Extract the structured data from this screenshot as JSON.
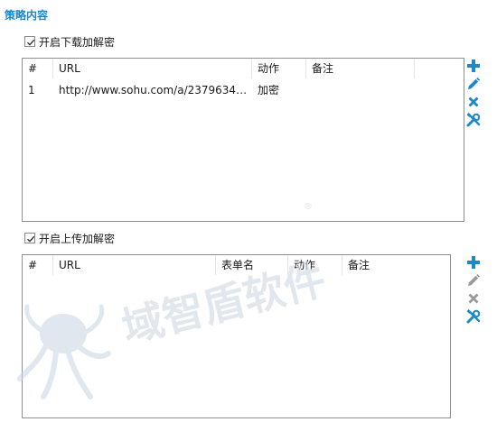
{
  "section": {
    "title": "策略内容"
  },
  "download": {
    "checkbox_label": "开启下载加解密",
    "checked": true,
    "columns": [
      "#",
      "URL",
      "动作",
      "备注"
    ],
    "rows": [
      {
        "num": "1",
        "url": "http://www.sohu.com/a/23796343...",
        "action": "加密",
        "note": ""
      }
    ]
  },
  "upload": {
    "checkbox_label": "开启上传加解密",
    "checked": true,
    "columns": [
      "#",
      "URL",
      "表单名",
      "动作",
      "备注"
    ],
    "rows": []
  },
  "toolbar_icons": [
    "add-icon",
    "edit-icon",
    "delete-icon",
    "settings-icon"
  ],
  "colors": {
    "accent": "#1a86c8",
    "icon_blue": "#1e88c9",
    "icon_disabled": "#9a9a9a",
    "border": "#8f8f8f"
  },
  "watermark": {
    "text": "域智盾软件",
    "mark": "®"
  }
}
